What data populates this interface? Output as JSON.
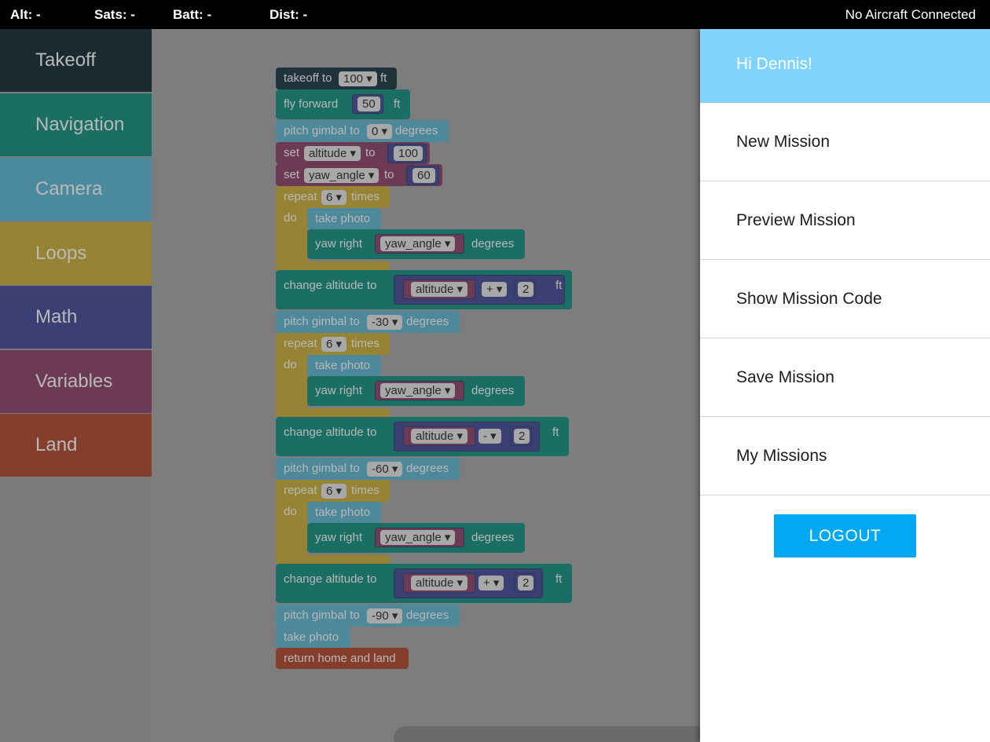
{
  "status": {
    "alt": "Alt: -",
    "sats": "Sats: -",
    "batt": "Batt: -",
    "dist": "Dist: -",
    "connection": "No Aircraft Connected"
  },
  "toolbox": {
    "categories": [
      "Takeoff",
      "Navigation",
      "Camera",
      "Loops",
      "Math",
      "Variables",
      "Land"
    ]
  },
  "blocks": {
    "takeoff": {
      "label": "takeoff to",
      "value": "100",
      "unit": "ft"
    },
    "fly_forward": {
      "label": "fly forward",
      "value": "50",
      "unit": "ft"
    },
    "pitch_label": "pitch gimbal to",
    "degrees": "degrees",
    "pitch_values": [
      "0",
      "-30",
      "-60",
      "-90"
    ],
    "set_label": "set",
    "to_label": "to",
    "set_altitude": {
      "var": "altitude",
      "value": "100"
    },
    "set_yaw": {
      "var": "yaw_angle",
      "value": "60"
    },
    "repeat_label": "repeat",
    "times_label": "times",
    "do_label": "do",
    "repeat_count": "6",
    "take_photo": "take photo",
    "yaw_right": "yaw right",
    "yaw_var": "yaw_angle",
    "change_alt_label": "change altitude to",
    "alt_var": "altitude",
    "ops": [
      "+",
      "-",
      "+"
    ],
    "alt_delta": "2",
    "ft": "ft",
    "return_home": "return home and land"
  },
  "menu": {
    "greeting": "Hi Dennis!",
    "items": [
      "New Mission",
      "Preview Mission",
      "Show Mission Code",
      "Save Mission",
      "My Missions"
    ],
    "logout": "LOGOUT"
  },
  "colors": {
    "greeting_bg": "#80d4fb",
    "logout_bg": "#00a9f2"
  }
}
